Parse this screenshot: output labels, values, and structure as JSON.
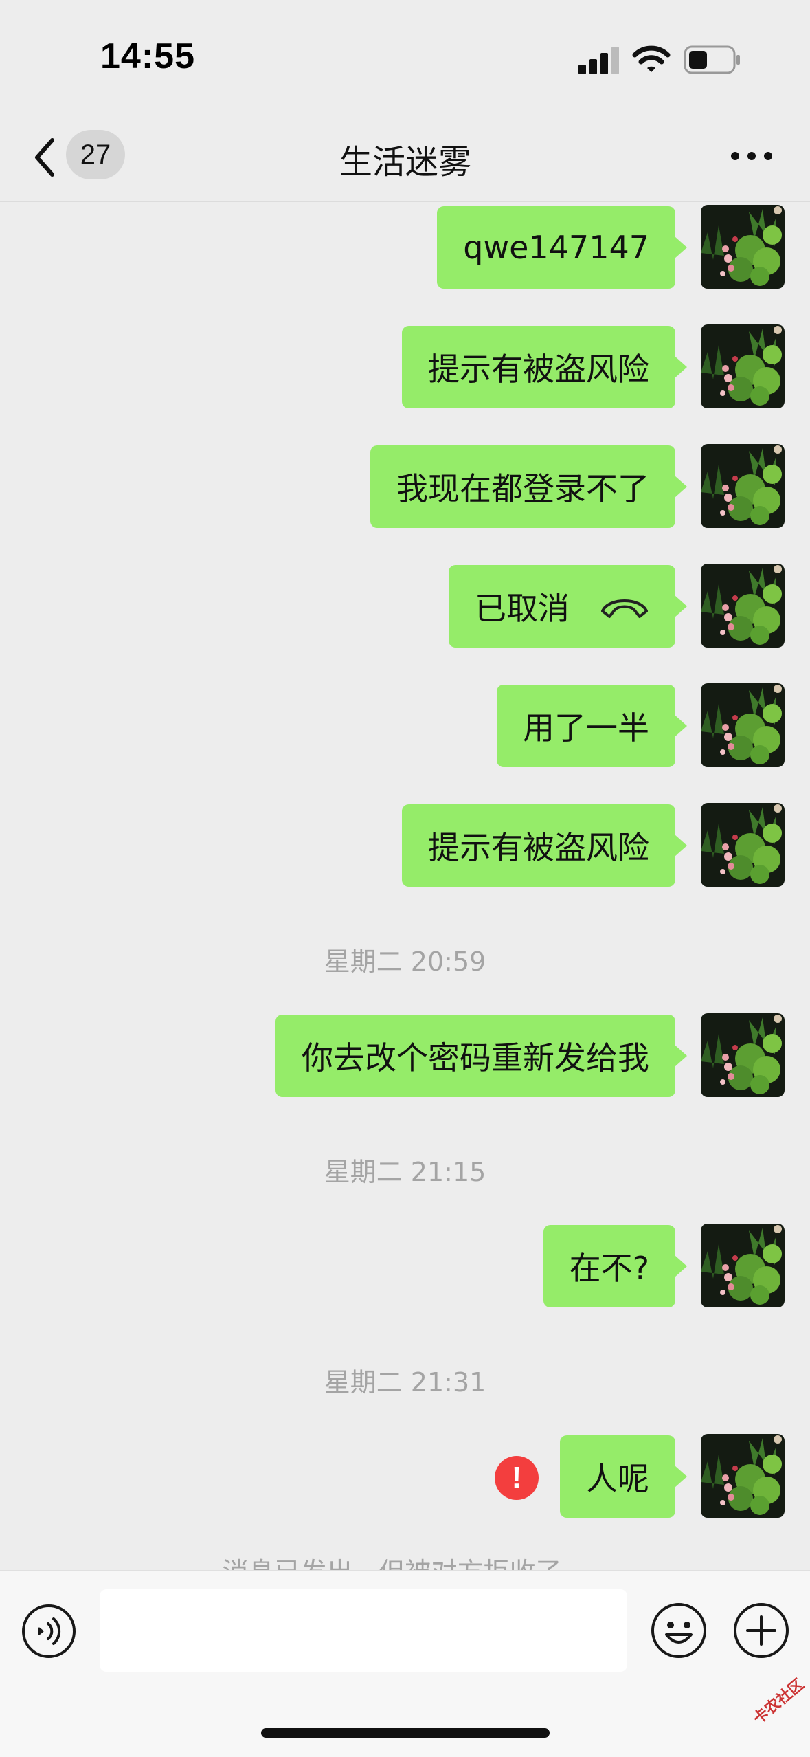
{
  "status_bar": {
    "time": "14:55"
  },
  "nav": {
    "unread_count": "27",
    "title": "生活迷雾"
  },
  "messages": [
    {
      "text": "qwe147147"
    },
    {
      "text": "提示有被盗风险"
    },
    {
      "text": "我现在都登录不了"
    },
    {
      "text": "已取消",
      "icon": "phone-hangup-icon"
    },
    {
      "text": "用了一半"
    },
    {
      "text": "提示有被盗风险"
    },
    {
      "time_separator": "星期二 20:59"
    },
    {
      "text": "你去改个密码重新发给我"
    },
    {
      "time_separator": "星期二 21:15"
    },
    {
      "text": "在不?"
    },
    {
      "time_separator": "星期二 21:31"
    },
    {
      "text": "人呢",
      "status": "failed",
      "status_icon": "exclamation-icon"
    }
  ],
  "system_notice": "消息已发出，但被对方拒收了。",
  "input_bar": {
    "value": "",
    "icons": [
      "voice-icon",
      "emoji-icon",
      "plus-icon"
    ]
  },
  "watermark": "卡农社区",
  "colors": {
    "background": "#ededed",
    "bubble_self": "#95ec69",
    "error": "#f33e3e",
    "timestamp_text": "#a4a4a4"
  }
}
